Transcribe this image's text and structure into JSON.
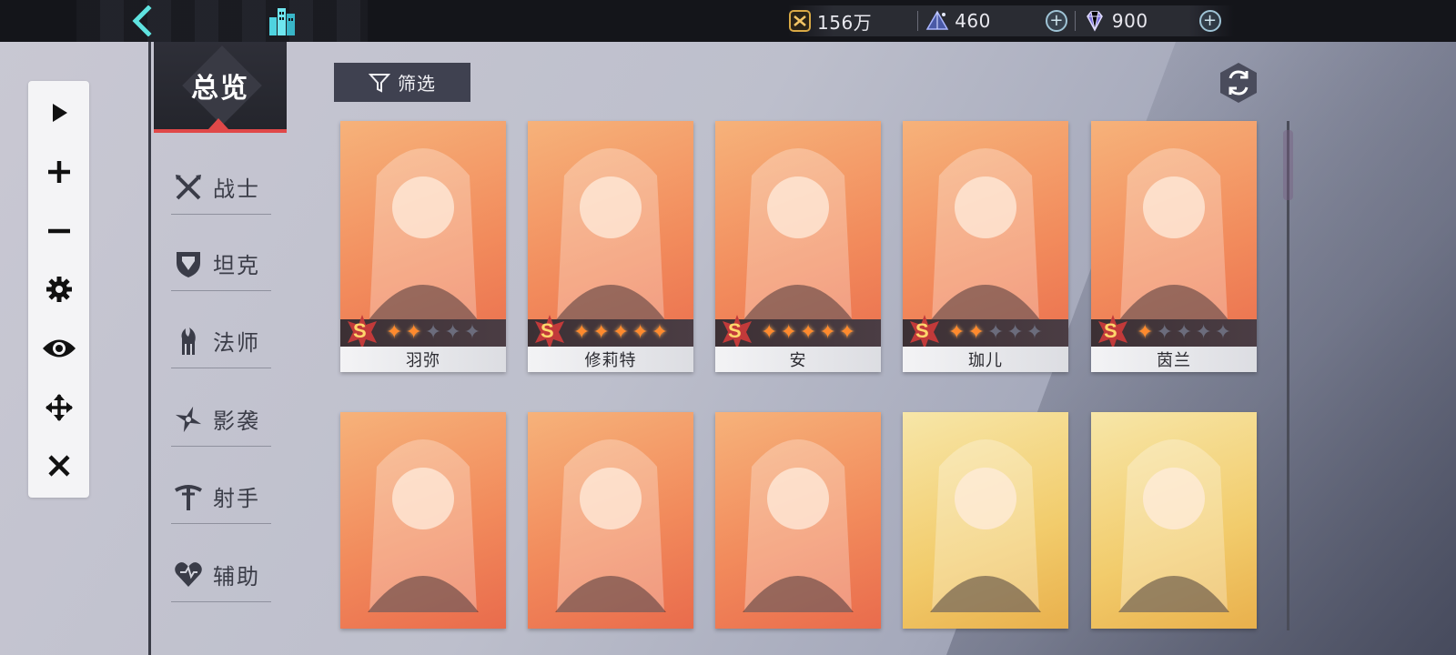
{
  "topbar": {
    "back_icon": "back-arrow-icon",
    "home_icon": "city-building-icon",
    "resources": [
      {
        "name": "gold",
        "icon": "gold-coin-icon",
        "value": "156万",
        "has_add": false
      },
      {
        "name": "crystal",
        "icon": "crystal-pyramid-icon",
        "value": "460",
        "has_add": true
      },
      {
        "name": "diamond",
        "icon": "diamond-icon",
        "value": "900",
        "has_add": true
      }
    ]
  },
  "toolbar": {
    "items": [
      {
        "name": "play",
        "icon": "play-icon"
      },
      {
        "name": "zoom-in",
        "icon": "plus-icon"
      },
      {
        "name": "zoom-out",
        "icon": "minus-icon"
      },
      {
        "name": "settings",
        "icon": "gear-icon"
      },
      {
        "name": "view",
        "icon": "eye-icon"
      },
      {
        "name": "move",
        "icon": "move-arrows-icon"
      },
      {
        "name": "close",
        "icon": "close-icon"
      }
    ]
  },
  "sidebar": {
    "overview_label": "总览",
    "classes": [
      {
        "label": "战士",
        "icon": "crossed-swords-icon"
      },
      {
        "label": "坦克",
        "icon": "shield-icon"
      },
      {
        "label": "法师",
        "icon": "flame-staff-icon"
      },
      {
        "label": "影袭",
        "icon": "shuriken-icon"
      },
      {
        "label": "射手",
        "icon": "crossbow-icon"
      },
      {
        "label": "辅助",
        "icon": "heart-icon"
      }
    ]
  },
  "controls": {
    "filter_label": "筛选",
    "filter_icon": "funnel-icon",
    "refresh_icon": "refresh-icon"
  },
  "colors": {
    "accent_red": "#e04848",
    "star_on": "#ff8a2e",
    "card_orange": "#f28b5c",
    "card_gold": "#f2cc6c"
  },
  "heroes": [
    {
      "name": "羽弥",
      "rank": "S",
      "stars": 2,
      "max_stars": 5
    },
    {
      "name": "修莉特",
      "rank": "S",
      "stars": 5,
      "max_stars": 5
    },
    {
      "name": "安",
      "rank": "S",
      "stars": 5,
      "max_stars": 5
    },
    {
      "name": "珈儿",
      "rank": "S",
      "stars": 2,
      "max_stars": 5
    },
    {
      "name": "茵兰",
      "rank": "S",
      "stars": 1,
      "max_stars": 5
    },
    {
      "name": "",
      "rank": "",
      "stars": 0,
      "max_stars": 5
    },
    {
      "name": "",
      "rank": "",
      "stars": 0,
      "max_stars": 5
    },
    {
      "name": "",
      "rank": "",
      "stars": 0,
      "max_stars": 5
    },
    {
      "name": "",
      "rank": "",
      "stars": 0,
      "max_stars": 5
    },
    {
      "name": "",
      "rank": "",
      "stars": 0,
      "max_stars": 5
    }
  ]
}
